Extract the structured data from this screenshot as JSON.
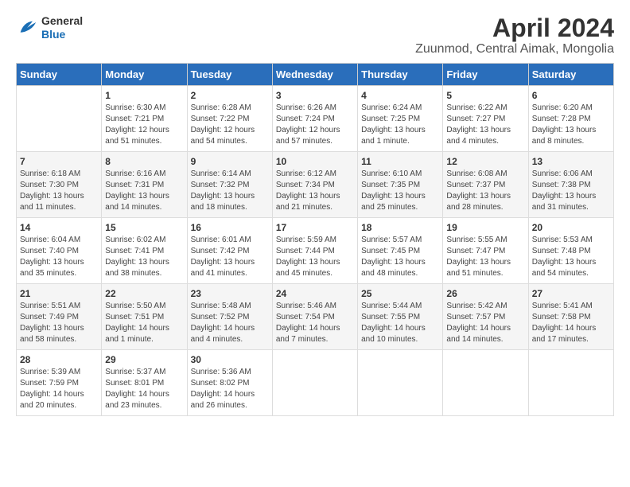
{
  "header": {
    "logo_general": "General",
    "logo_blue": "Blue",
    "title": "April 2024",
    "subtitle": "Zuunmod, Central Aimak, Mongolia"
  },
  "days_of_week": [
    "Sunday",
    "Monday",
    "Tuesday",
    "Wednesday",
    "Thursday",
    "Friday",
    "Saturday"
  ],
  "weeks": [
    [
      {
        "day": "",
        "content": ""
      },
      {
        "day": "1",
        "content": "Sunrise: 6:30 AM\nSunset: 7:21 PM\nDaylight: 12 hours\nand 51 minutes."
      },
      {
        "day": "2",
        "content": "Sunrise: 6:28 AM\nSunset: 7:22 PM\nDaylight: 12 hours\nand 54 minutes."
      },
      {
        "day": "3",
        "content": "Sunrise: 6:26 AM\nSunset: 7:24 PM\nDaylight: 12 hours\nand 57 minutes."
      },
      {
        "day": "4",
        "content": "Sunrise: 6:24 AM\nSunset: 7:25 PM\nDaylight: 13 hours\nand 1 minute."
      },
      {
        "day": "5",
        "content": "Sunrise: 6:22 AM\nSunset: 7:27 PM\nDaylight: 13 hours\nand 4 minutes."
      },
      {
        "day": "6",
        "content": "Sunrise: 6:20 AM\nSunset: 7:28 PM\nDaylight: 13 hours\nand 8 minutes."
      }
    ],
    [
      {
        "day": "7",
        "content": "Sunrise: 6:18 AM\nSunset: 7:30 PM\nDaylight: 13 hours\nand 11 minutes."
      },
      {
        "day": "8",
        "content": "Sunrise: 6:16 AM\nSunset: 7:31 PM\nDaylight: 13 hours\nand 14 minutes."
      },
      {
        "day": "9",
        "content": "Sunrise: 6:14 AM\nSunset: 7:32 PM\nDaylight: 13 hours\nand 18 minutes."
      },
      {
        "day": "10",
        "content": "Sunrise: 6:12 AM\nSunset: 7:34 PM\nDaylight: 13 hours\nand 21 minutes."
      },
      {
        "day": "11",
        "content": "Sunrise: 6:10 AM\nSunset: 7:35 PM\nDaylight: 13 hours\nand 25 minutes."
      },
      {
        "day": "12",
        "content": "Sunrise: 6:08 AM\nSunset: 7:37 PM\nDaylight: 13 hours\nand 28 minutes."
      },
      {
        "day": "13",
        "content": "Sunrise: 6:06 AM\nSunset: 7:38 PM\nDaylight: 13 hours\nand 31 minutes."
      }
    ],
    [
      {
        "day": "14",
        "content": "Sunrise: 6:04 AM\nSunset: 7:40 PM\nDaylight: 13 hours\nand 35 minutes."
      },
      {
        "day": "15",
        "content": "Sunrise: 6:02 AM\nSunset: 7:41 PM\nDaylight: 13 hours\nand 38 minutes."
      },
      {
        "day": "16",
        "content": "Sunrise: 6:01 AM\nSunset: 7:42 PM\nDaylight: 13 hours\nand 41 minutes."
      },
      {
        "day": "17",
        "content": "Sunrise: 5:59 AM\nSunset: 7:44 PM\nDaylight: 13 hours\nand 45 minutes."
      },
      {
        "day": "18",
        "content": "Sunrise: 5:57 AM\nSunset: 7:45 PM\nDaylight: 13 hours\nand 48 minutes."
      },
      {
        "day": "19",
        "content": "Sunrise: 5:55 AM\nSunset: 7:47 PM\nDaylight: 13 hours\nand 51 minutes."
      },
      {
        "day": "20",
        "content": "Sunrise: 5:53 AM\nSunset: 7:48 PM\nDaylight: 13 hours\nand 54 minutes."
      }
    ],
    [
      {
        "day": "21",
        "content": "Sunrise: 5:51 AM\nSunset: 7:49 PM\nDaylight: 13 hours\nand 58 minutes."
      },
      {
        "day": "22",
        "content": "Sunrise: 5:50 AM\nSunset: 7:51 PM\nDaylight: 14 hours\nand 1 minute."
      },
      {
        "day": "23",
        "content": "Sunrise: 5:48 AM\nSunset: 7:52 PM\nDaylight: 14 hours\nand 4 minutes."
      },
      {
        "day": "24",
        "content": "Sunrise: 5:46 AM\nSunset: 7:54 PM\nDaylight: 14 hours\nand 7 minutes."
      },
      {
        "day": "25",
        "content": "Sunrise: 5:44 AM\nSunset: 7:55 PM\nDaylight: 14 hours\nand 10 minutes."
      },
      {
        "day": "26",
        "content": "Sunrise: 5:42 AM\nSunset: 7:57 PM\nDaylight: 14 hours\nand 14 minutes."
      },
      {
        "day": "27",
        "content": "Sunrise: 5:41 AM\nSunset: 7:58 PM\nDaylight: 14 hours\nand 17 minutes."
      }
    ],
    [
      {
        "day": "28",
        "content": "Sunrise: 5:39 AM\nSunset: 7:59 PM\nDaylight: 14 hours\nand 20 minutes."
      },
      {
        "day": "29",
        "content": "Sunrise: 5:37 AM\nSunset: 8:01 PM\nDaylight: 14 hours\nand 23 minutes."
      },
      {
        "day": "30",
        "content": "Sunrise: 5:36 AM\nSunset: 8:02 PM\nDaylight: 14 hours\nand 26 minutes."
      },
      {
        "day": "",
        "content": ""
      },
      {
        "day": "",
        "content": ""
      },
      {
        "day": "",
        "content": ""
      },
      {
        "day": "",
        "content": ""
      }
    ]
  ]
}
